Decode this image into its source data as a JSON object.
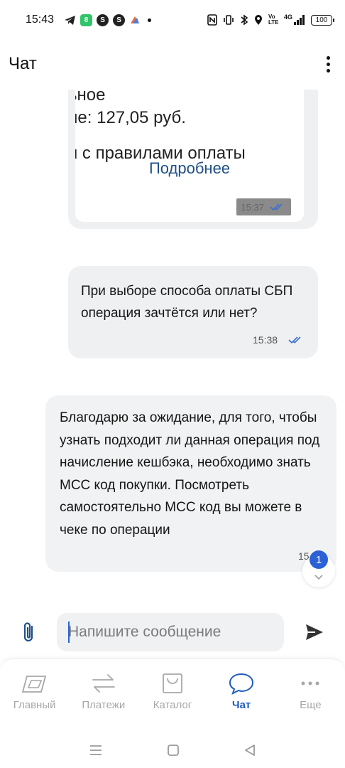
{
  "status_bar": {
    "time": "15:43",
    "apps": [
      {
        "icon": "telegram-icon",
        "color": "#222222"
      },
      {
        "icon": "app-green-icon",
        "glyph": "8",
        "color": "#31c46a"
      },
      {
        "icon": "app-s-icon",
        "glyph": "S",
        "color": "#222222"
      },
      {
        "icon": "app-s-icon",
        "glyph": "S",
        "color": "#222222"
      },
      {
        "icon": "app-colorful-icon",
        "color": "#e86b3b"
      }
    ],
    "volte_label": "Vo LTE",
    "network": "4G",
    "battery": "100"
  },
  "header": {
    "title": "Чат"
  },
  "messages": {
    "card": {
      "lines": [
        "ьное",
        "ие: 127,05 руб.",
        "н с правилами оплаты"
      ],
      "link": "Подробнее",
      "time": "15:37"
    },
    "outgoing": {
      "text": "При выборе способа оплаты СБП операция зачтётся или нет?",
      "time": "15:38"
    },
    "incoming": {
      "text": "Благодарю за ожидание, для того, чтобы узнать подходит ли данная операция под начисление кешбэка, необходимо знать МСС код покупки. Посмотреть самостоятельно МСС код вы можете в чеке по операции",
      "time": "15"
    },
    "unread_count": "1"
  },
  "composer": {
    "placeholder": "Напишите сообщение"
  },
  "bottom_nav": [
    {
      "label": "Главный",
      "icon": "home-card-icon",
      "active": false
    },
    {
      "label": "Платежи",
      "icon": "transfer-arrows-icon",
      "active": false
    },
    {
      "label": "Каталог",
      "icon": "catalog-bag-icon",
      "active": false
    },
    {
      "label": "Чат",
      "icon": "chat-bubble-icon",
      "active": true
    },
    {
      "label": "Еще",
      "icon": "more-dots-icon",
      "active": false
    }
  ],
  "colors": {
    "accent": "#1f5bbf",
    "link": "#1f4f86",
    "badge": "#2a62d6",
    "inactive": "#a7a7a7"
  }
}
